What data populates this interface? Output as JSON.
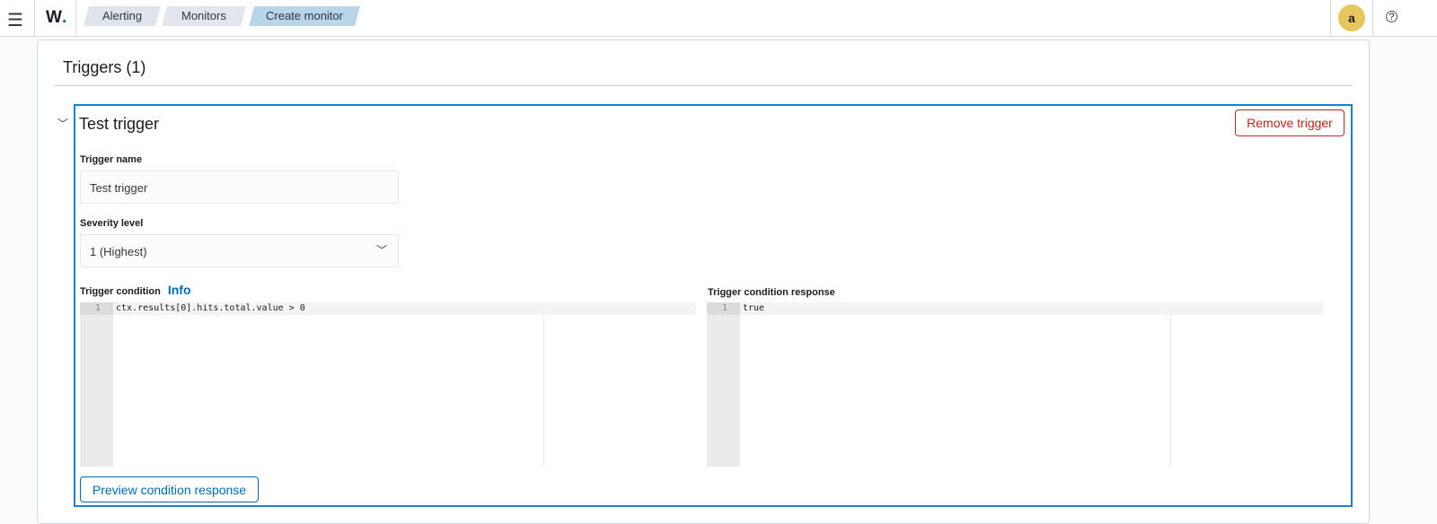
{
  "header": {
    "logo": "W",
    "breadcrumbs": [
      "Alerting",
      "Monitors",
      "Create monitor"
    ],
    "avatar": "a",
    "help_icon": "?"
  },
  "section": {
    "title": "Triggers (1)"
  },
  "trigger": {
    "name": "Test trigger",
    "remove_label": "Remove trigger",
    "name_label": "Trigger name",
    "name_value": "Test trigger",
    "severity_label": "Severity level",
    "severity_value": "1 (Highest)",
    "condition_label": "Trigger condition",
    "info_link": "Info",
    "condition_line_no": "1",
    "condition_code": "ctx.results[0].hits.total.value > 0",
    "response_label": "Trigger condition response",
    "response_line_no": "1",
    "response_code": "true",
    "preview_label": "Preview condition response"
  }
}
